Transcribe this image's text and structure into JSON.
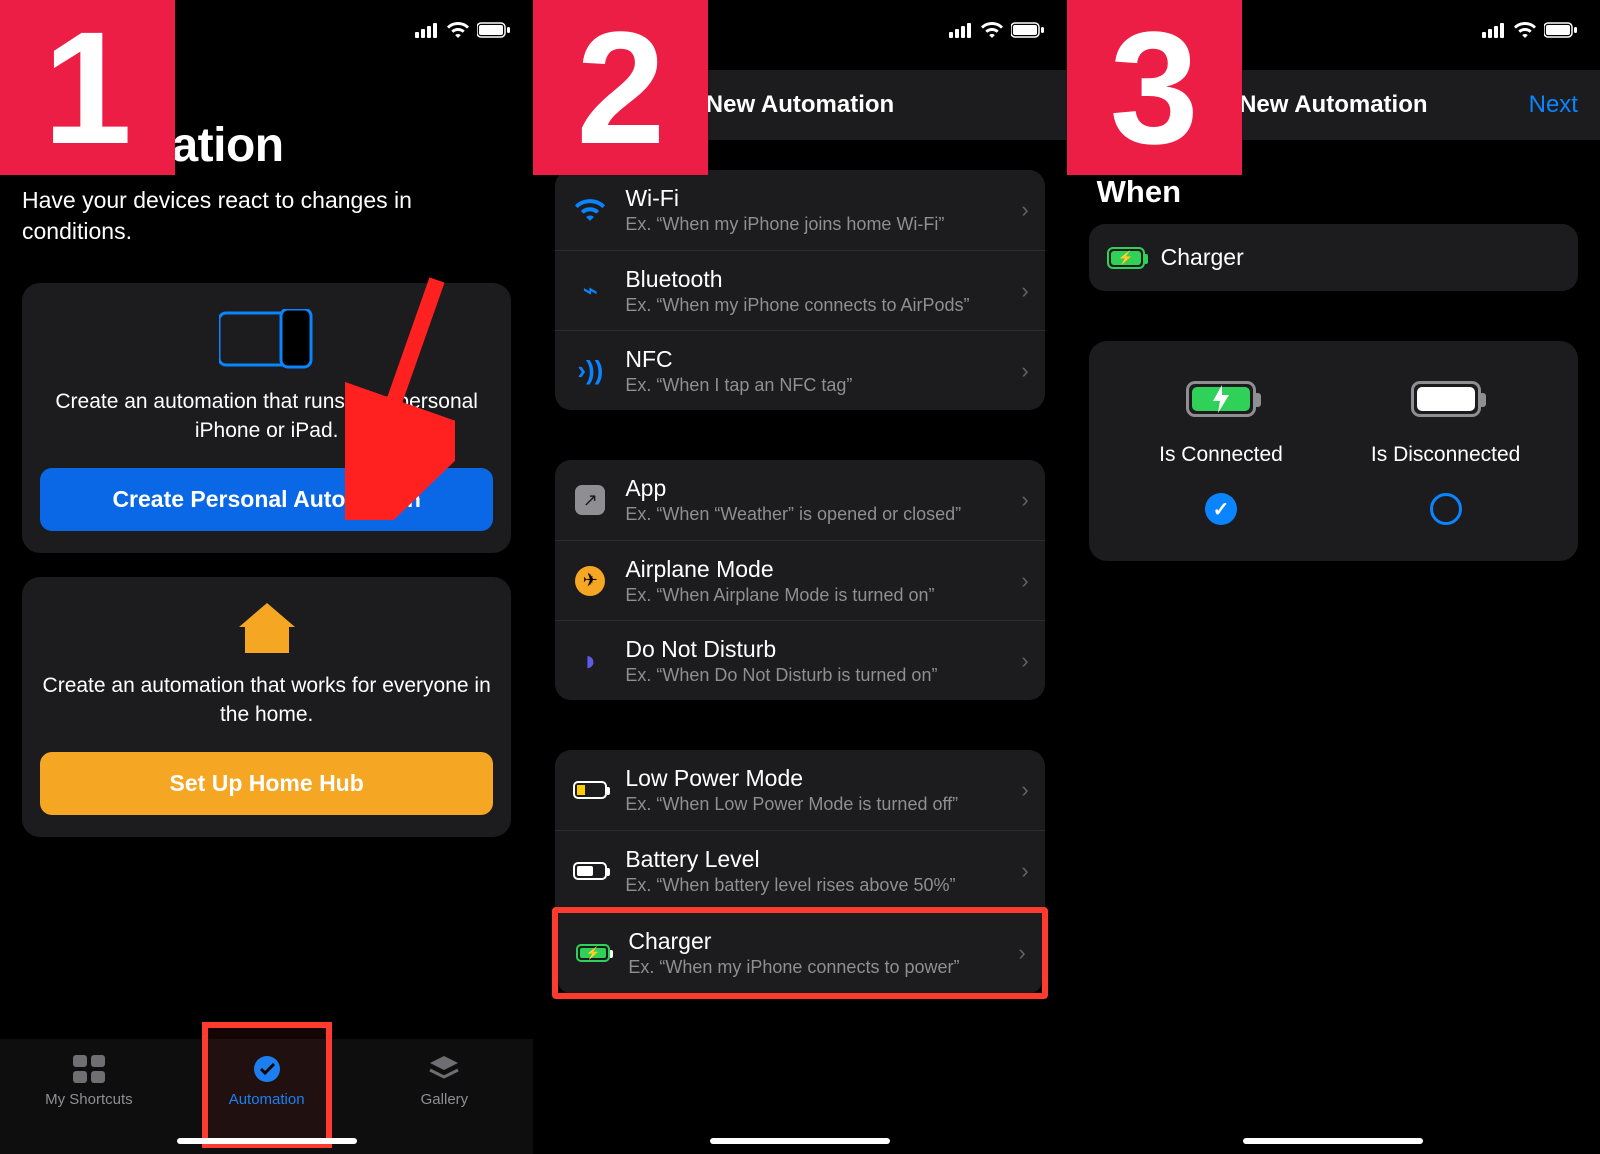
{
  "steps": [
    "1",
    "2",
    "3"
  ],
  "screen1": {
    "title": "Automation",
    "subtitle": "Have your devices react to changes in conditions.",
    "card1_text": "Create an automation that runs on a personal iPhone or iPad.",
    "card1_button": "Create Personal Automation",
    "card2_text": "Create an automation that works for everyone in the home.",
    "card2_button": "Set Up Home Hub",
    "tabs": {
      "shortcuts": "My Shortcuts",
      "automation": "Automation",
      "gallery": "Gallery"
    }
  },
  "screen2": {
    "nav_title": "New Automation",
    "g1": [
      {
        "t": "Wi-Fi",
        "s": "Ex. “When my iPhone joins home Wi-Fi”"
      },
      {
        "t": "Bluetooth",
        "s": "Ex. “When my iPhone connects to AirPods”"
      },
      {
        "t": "NFC",
        "s": "Ex. “When I tap an NFC tag”"
      }
    ],
    "g2": [
      {
        "t": "App",
        "s": "Ex. “When “Weather” is opened or closed”"
      },
      {
        "t": "Airplane Mode",
        "s": "Ex. “When Airplane Mode is turned on”"
      },
      {
        "t": "Do Not Disturb",
        "s": "Ex. “When Do Not Disturb is turned on”"
      }
    ],
    "g3": [
      {
        "t": "Low Power Mode",
        "s": "Ex. “When Low Power Mode is turned off”"
      },
      {
        "t": "Battery Level",
        "s": "Ex. “When battery level rises above 50%”"
      },
      {
        "t": "Charger",
        "s": "Ex. “When my iPhone connects to power”"
      }
    ]
  },
  "screen3": {
    "nav_title": "New Automation",
    "next": "Next",
    "section": "When",
    "trigger": "Charger",
    "opt_connected": "Is Connected",
    "opt_disconnected": "Is Disconnected"
  }
}
